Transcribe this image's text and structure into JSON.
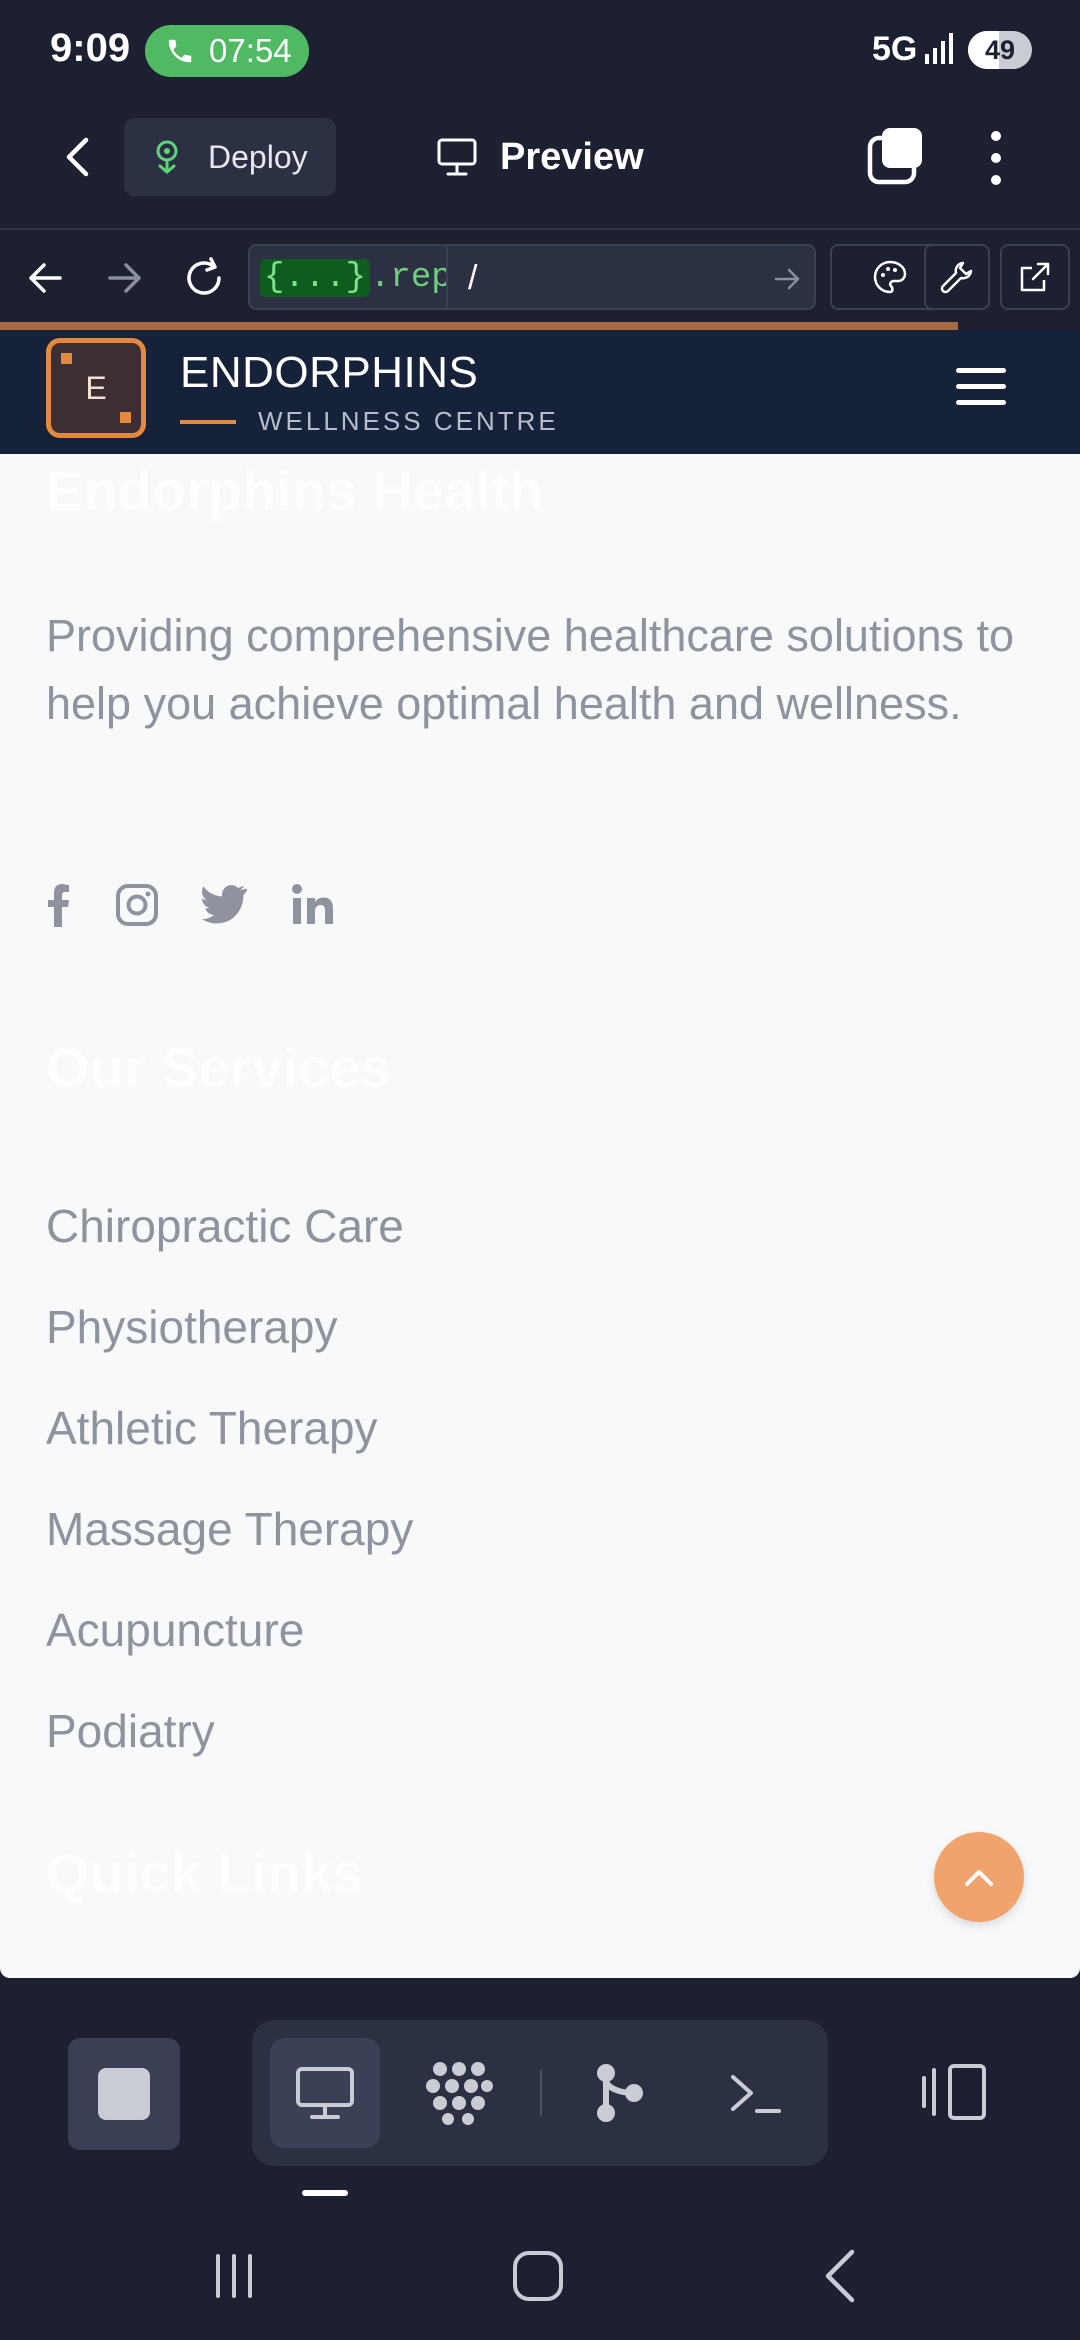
{
  "status_bar": {
    "time": "9:09",
    "call_timer": "07:54",
    "network": "5G",
    "battery": "49",
    "battery_level_percent": 49,
    "icons": [
      "phone-icon",
      "signal-icon",
      "battery-icon"
    ]
  },
  "replit_bar": {
    "deploy_label": "Deploy",
    "preview_label": "Preview",
    "icons": [
      "back-arrow-icon",
      "deploy-icon",
      "monitor-icon",
      "tabs-icon",
      "more-vertical-icon"
    ]
  },
  "url_bar": {
    "host_badge": "{...}",
    "host": ".replit.c",
    "path": "/",
    "icons": [
      "nav-back-icon",
      "nav-forward-icon",
      "reload-icon",
      "go-arrow-icon",
      "palette-icon",
      "wrench-icon",
      "external-link-icon"
    ]
  },
  "site": {
    "logo_letter": "E",
    "brand_name": "ENDORPHINS",
    "brand_tagline": "WELLNESS CENTRE",
    "footer_title": "Endorphins Health",
    "about_text": "Providing comprehensive healthcare solutions to help you achieve optimal health and wellness.",
    "social_icons": [
      "facebook-icon",
      "instagram-icon",
      "twitter-icon",
      "linkedin-icon"
    ],
    "services_heading": "Our Services",
    "services": [
      "Chiropractic Care",
      "Physiotherapy",
      "Athletic Therapy",
      "Massage Therapy",
      "Acupuncture",
      "Podiatry"
    ],
    "quick_links_heading": "Quick Links",
    "colors": {
      "header_bg": "#16213a",
      "accent": "#e48a3f",
      "scroll_top_bg": "#f1a36d",
      "page_bg": "#f8f9fb",
      "muted_text": "#8e939d"
    }
  },
  "bottom_toolbar": {
    "icons": [
      "stop-icon",
      "webview-icon",
      "workspace-icon",
      "git-icon",
      "shell-icon",
      "devices-icon"
    ],
    "active_tool": "webview"
  },
  "system_nav": {
    "icons": [
      "recents-icon",
      "home-icon",
      "back-icon"
    ]
  }
}
